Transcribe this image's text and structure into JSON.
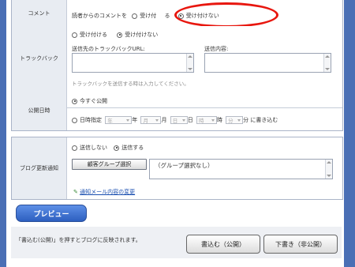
{
  "comment": {
    "label": "コメント",
    "prefix": "読者からのコメントを",
    "accept": "受け付",
    "partial": "る",
    "reject": "受け付けない"
  },
  "trackback": {
    "label": "トラックバック",
    "accept": "受け付ける",
    "reject": "受け付けない",
    "url_label": "送信先のトラックバックURL:",
    "content_label": "送信内容:",
    "hint": "トラックバックを送信する時は入力してください。"
  },
  "publish": {
    "label": "公開日時",
    "now": "今すぐ公開",
    "specify": "日時指定",
    "year_sel": "年",
    "year_unit": "年",
    "month_sel": "月",
    "month_unit": "月",
    "day_sel": "日",
    "day_unit": "日",
    "hour_sel": "時",
    "hour_unit": "時",
    "min_sel": "分",
    "suffix": "分 に書き込む"
  },
  "notify": {
    "label": "ブログ更新通知",
    "no_send": "送信しない",
    "send": "送信する",
    "group_button": "顧客グループ選択",
    "group_value": "（グループ選択なし）",
    "mail_link": "通知メール内容の変更"
  },
  "footer": {
    "preview": "プレビュー",
    "note": "「書込む(公開)」を押すとブログに反映されます。",
    "publish_button": "書込む（公開）",
    "draft_button": "下書き（非公開）"
  },
  "colors": {
    "side": "#4a6fb5",
    "highlight": "#e8160e",
    "preview": "#3d6fd4"
  }
}
